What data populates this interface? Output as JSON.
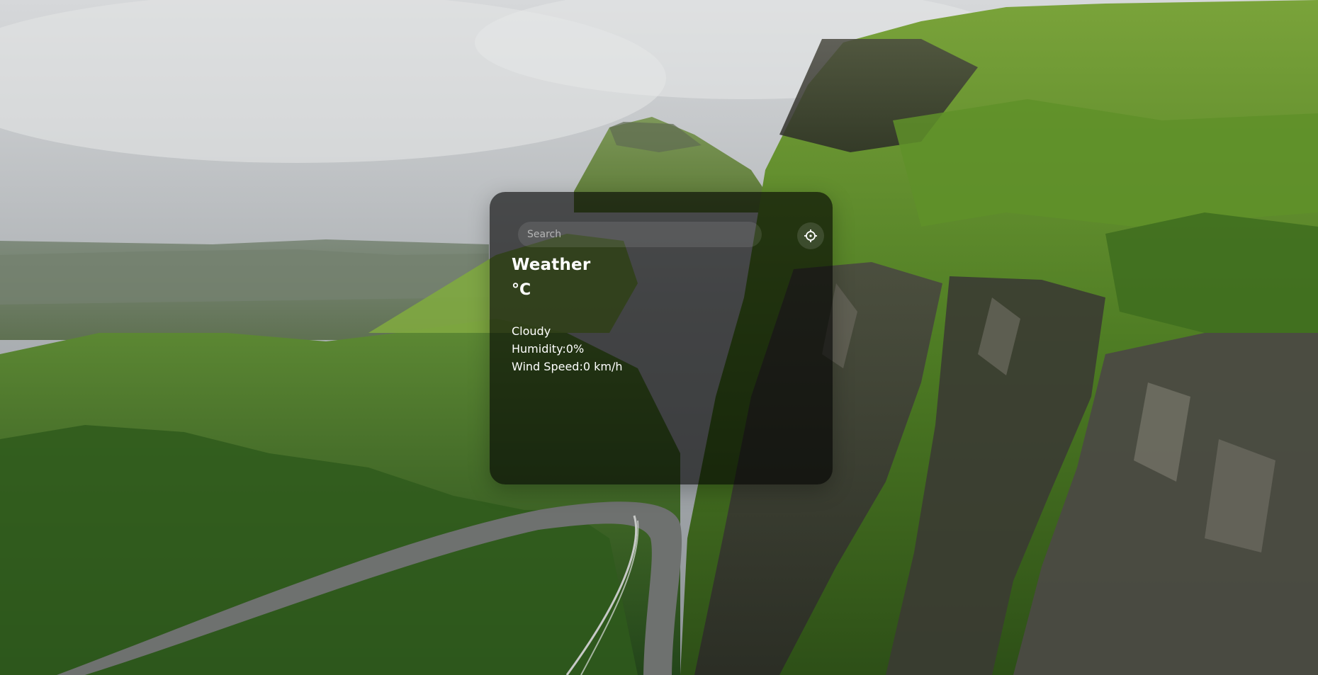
{
  "search": {
    "placeholder": "Search",
    "value": ""
  },
  "locate_button": {
    "icon": "crosshair-icon"
  },
  "weather": {
    "title": "Weather",
    "temperature": "°C",
    "condition": "Cloudy",
    "humidity": "Humidity:0%",
    "wind_speed": "Wind Speed:0 km/h"
  },
  "colors": {
    "card_bg": "#000000",
    "text": "#ffffff"
  }
}
